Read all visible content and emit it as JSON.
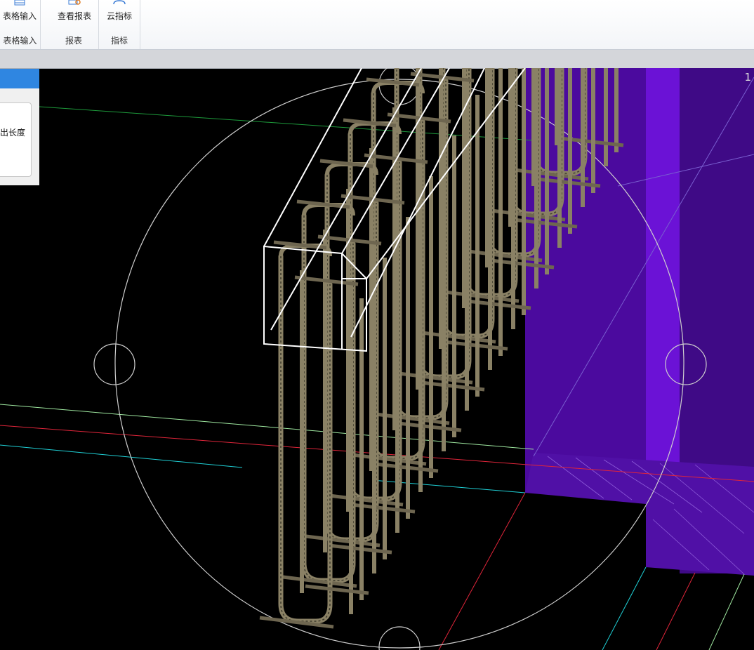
{
  "ribbon": {
    "groups": [
      {
        "button": "表格输入",
        "label": "表格输入"
      },
      {
        "button": "查看报表",
        "label": "报表"
      },
      {
        "button": "云指标",
        "label": "指标"
      }
    ]
  },
  "side_panel": {
    "text": "出长度"
  },
  "viewport": {
    "corner_text": "1"
  },
  "colors": {
    "background": "#000000",
    "wall": "#4b0a9e",
    "wall_light": "#6b12d6",
    "rebar": "#8a8165",
    "panel_header": "#2f86e1"
  }
}
